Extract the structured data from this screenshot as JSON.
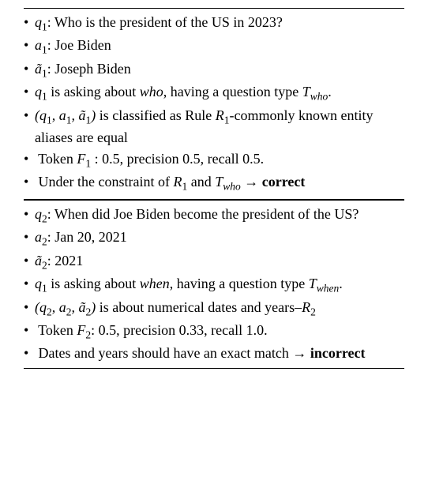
{
  "bullet": "•",
  "block1": {
    "l1a": "q",
    "l1b": "1",
    "l1c": ": Who is the president of the US in 2023?",
    "l2a": "a",
    "l2b": "1",
    "l2c": ": Joe Biden",
    "l3a": "ã",
    "l3b": "1",
    "l3c": ": Joseph Biden",
    "l4a": "q",
    "l4b": "1",
    "l4c": " is asking about ",
    "l4d": "who",
    "l4e": ", having a question type ",
    "l4f": "T",
    "l4g": "who",
    "l4h": ".",
    "l5a": "(q",
    "l5b": "1",
    "l5c": ", a",
    "l5d": "1",
    "l5e": ", ã",
    "l5f": "1",
    "l5g": ")",
    "l5h": " is classified as Rule ",
    "l5i": "R",
    "l5j": "1",
    "l5k": "-commonly known entity aliases are equal",
    "l6a": " Token ",
    "l6b": "F",
    "l6c": "1",
    "l6d": " : 0.5, precision 0.5, recall 0.5.",
    "l7a": " Under the constraint of ",
    "l7b": "R",
    "l7c": "1",
    "l7d": " and ",
    "l7e": "T",
    "l7f": "who",
    "l7g": " → ",
    "l7h": "correct"
  },
  "block2": {
    "l1a": "q",
    "l1b": "2",
    "l1c": ": When did Joe Biden become the president of the US?",
    "l2a": "a",
    "l2b": "2",
    "l2c": ": Jan 20, 2021",
    "l3a": "ã",
    "l3b": "2",
    "l3c": ": 2021",
    "l4a": "q",
    "l4b": "1",
    "l4c": " is asking about ",
    "l4d": "when",
    "l4e": ", having a question type ",
    "l4f": "T",
    "l4g": "when",
    "l4h": ".",
    "l5a": "(q",
    "l5b": "2",
    "l5c": ", a",
    "l5d": "2",
    "l5e": ", ã",
    "l5f": "2",
    "l5g": ")",
    "l5h": " is about numerical dates and years–",
    "l5i": "R",
    "l5j": "2",
    "l6a": " Token ",
    "l6b": "F",
    "l6c": "2",
    "l6d": ": 0.5, precision 0.33, recall 1.0.",
    "l7a": " Dates and years should have an exact match → ",
    "l7b": "incorrect"
  }
}
